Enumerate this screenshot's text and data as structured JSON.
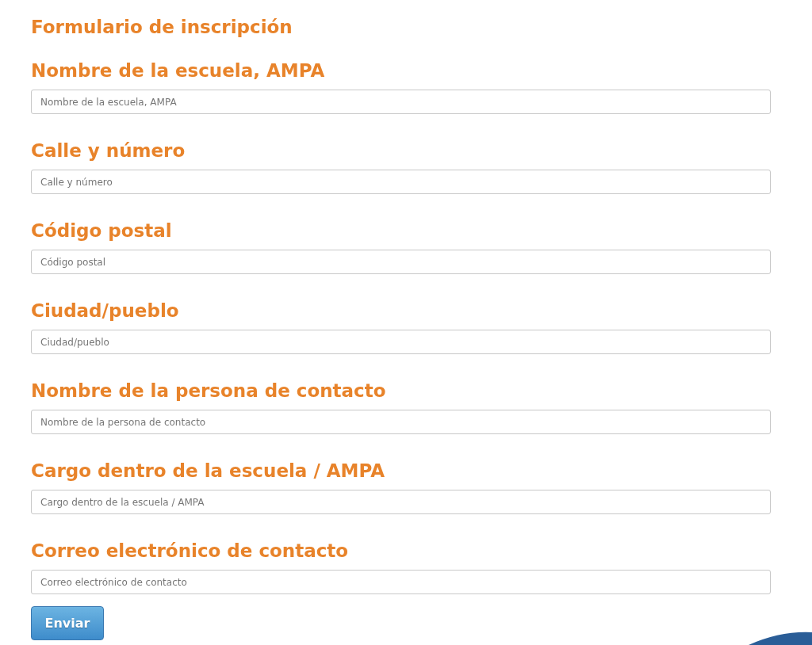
{
  "title": "Formulario de inscripción",
  "fields": [
    {
      "label": "Nombre de la escuela, AMPA",
      "placeholder": "Nombre de la escuela, AMPA"
    },
    {
      "label": "Calle y número",
      "placeholder": "Calle y número"
    },
    {
      "label": "Código postal",
      "placeholder": "Código postal"
    },
    {
      "label": "Ciudad/pueblo",
      "placeholder": "Ciudad/pueblo"
    },
    {
      "label": "Nombre de la persona de contacto",
      "placeholder": "Nombre de la persona de contacto"
    },
    {
      "label": "Cargo dentro de la escuela / AMPA",
      "placeholder": "Cargo dentro de la escuela / AMPA"
    },
    {
      "label": "Correo electrónico de contacto",
      "placeholder": "Correo electrónico de contacto"
    }
  ],
  "submit": "Enviar"
}
